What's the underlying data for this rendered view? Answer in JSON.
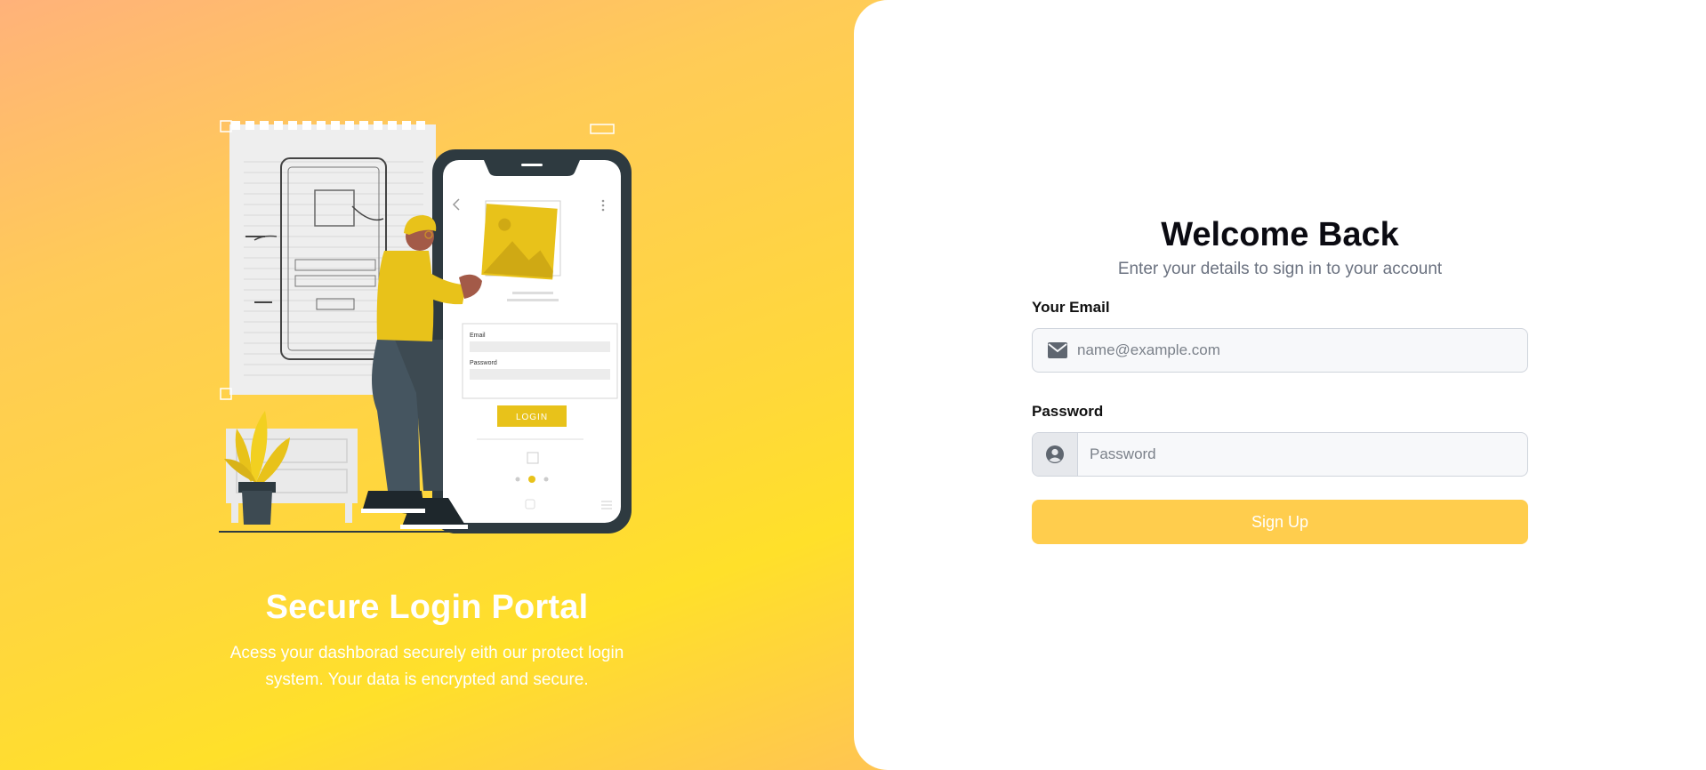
{
  "hero": {
    "title": "Secure Login Portal",
    "description": "Acess your dashborad securely eith our protect login system. Your data is encrypted and secure.",
    "illustration": {
      "phone_email_label": "Email",
      "phone_password_label": "Password",
      "phone_login_button": "LOGIN"
    }
  },
  "form": {
    "title": "Welcome Back",
    "subtitle": "Enter your details to sign in to your account",
    "email_label": "Your Email",
    "email_placeholder": "name@example.com",
    "email_icon": "envelope-icon",
    "password_label": "Password",
    "password_placeholder": "Password",
    "password_icon": "user-circle-icon",
    "submit_label": "Sign Up"
  },
  "colors": {
    "accent": "#ffcd4d",
    "gradient_yellow": "#ffe02a",
    "gradient_peach": "#ff9f8a",
    "illustration_yellow": "#e8c21a",
    "illustration_dark": "#2e3a40"
  }
}
